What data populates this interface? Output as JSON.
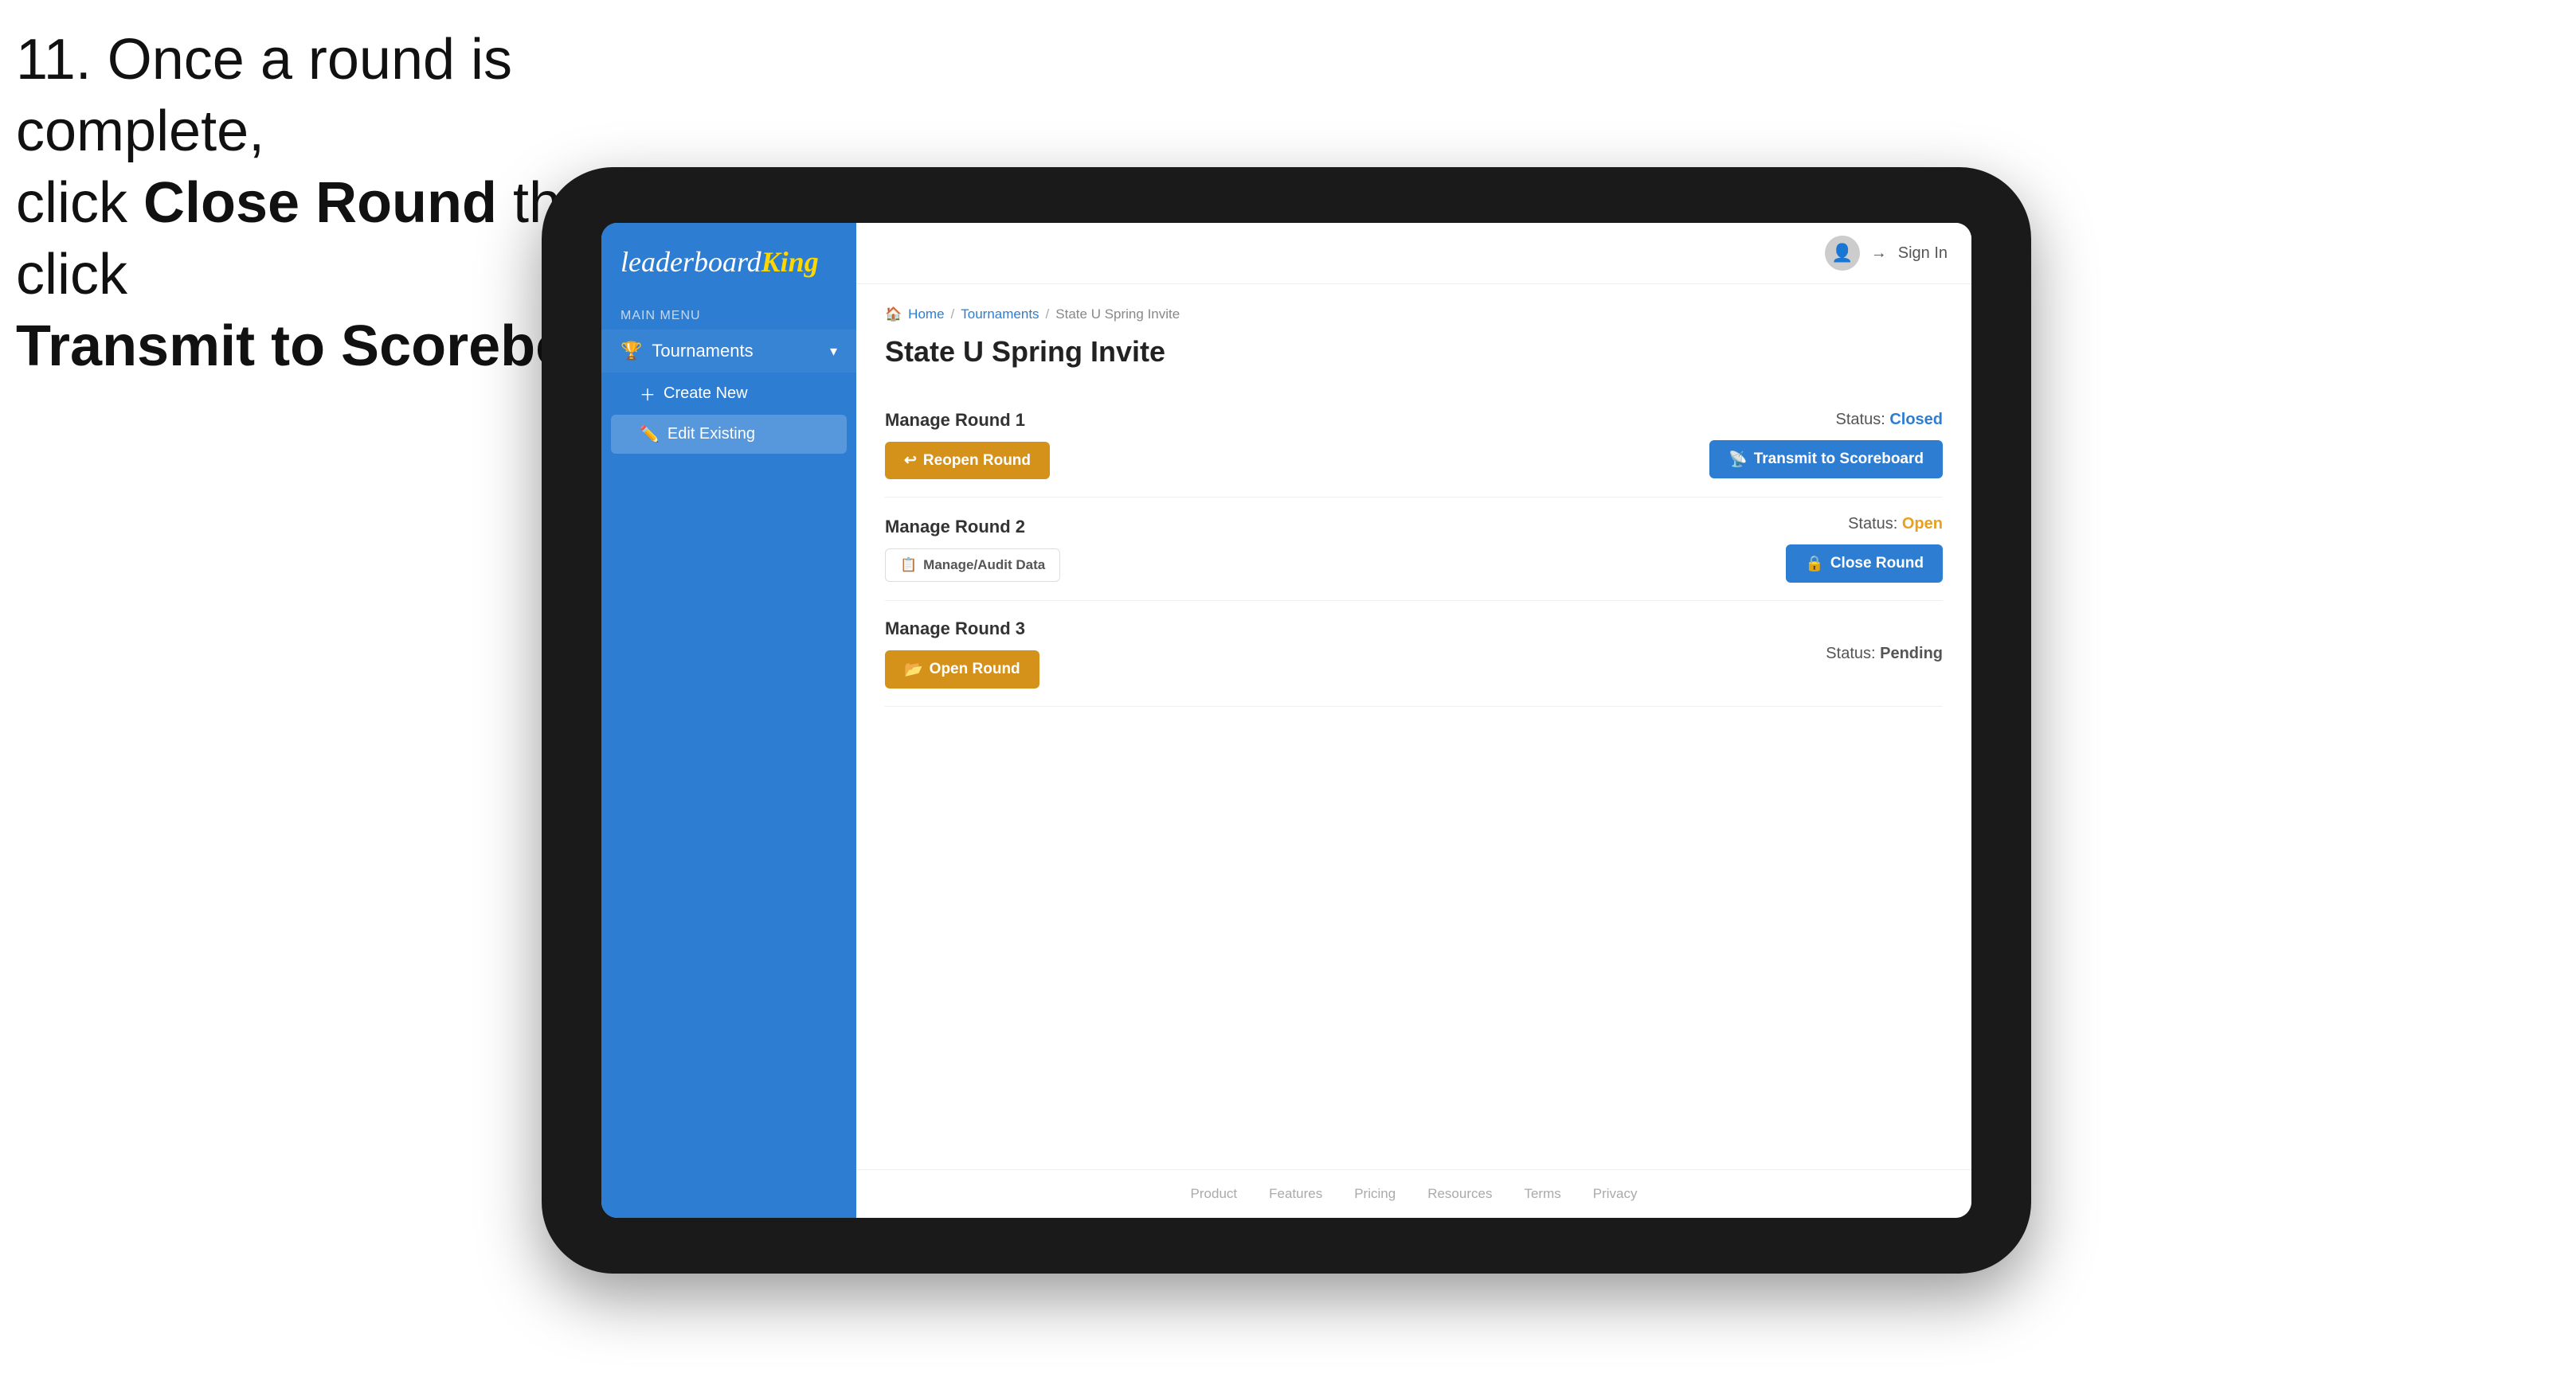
{
  "instruction": {
    "line1": "11. Once a round is complete,",
    "line2_prefix": "click ",
    "line2_bold": "Close Round",
    "line2_suffix": " then click",
    "line3_bold": "Transmit to Scoreboard."
  },
  "sidebar": {
    "logo_leaderboard": "leaderboard",
    "logo_king": "King",
    "main_menu_label": "MAIN MENU",
    "tournaments_label": "Tournaments",
    "create_new_label": "Create New",
    "edit_existing_label": "Edit Existing"
  },
  "header": {
    "sign_in_label": "Sign In"
  },
  "breadcrumb": {
    "home": "Home",
    "sep1": "/",
    "tournaments": "Tournaments",
    "sep2": "/",
    "current": "State U Spring Invite"
  },
  "page": {
    "title": "State U Spring Invite"
  },
  "rounds": [
    {
      "id": 1,
      "title": "Manage Round 1",
      "status_label": "Status:",
      "status_value": "Closed",
      "status_type": "closed",
      "left_button": "Reopen Round",
      "left_button_type": "amber",
      "right_button": "Transmit to Scoreboard",
      "right_button_type": "blue"
    },
    {
      "id": 2,
      "title": "Manage Round 2",
      "status_label": "Status:",
      "status_value": "Open",
      "status_type": "open",
      "left_button": "Manage/Audit Data",
      "left_button_type": "outline",
      "right_button": "Close Round",
      "right_button_type": "blue"
    },
    {
      "id": 3,
      "title": "Manage Round 3",
      "status_label": "Status:",
      "status_value": "Pending",
      "status_type": "pending",
      "left_button": "Open Round",
      "left_button_type": "amber",
      "right_button": null,
      "right_button_type": null
    }
  ],
  "footer": {
    "links": [
      "Product",
      "Features",
      "Pricing",
      "Resources",
      "Terms",
      "Privacy"
    ]
  }
}
